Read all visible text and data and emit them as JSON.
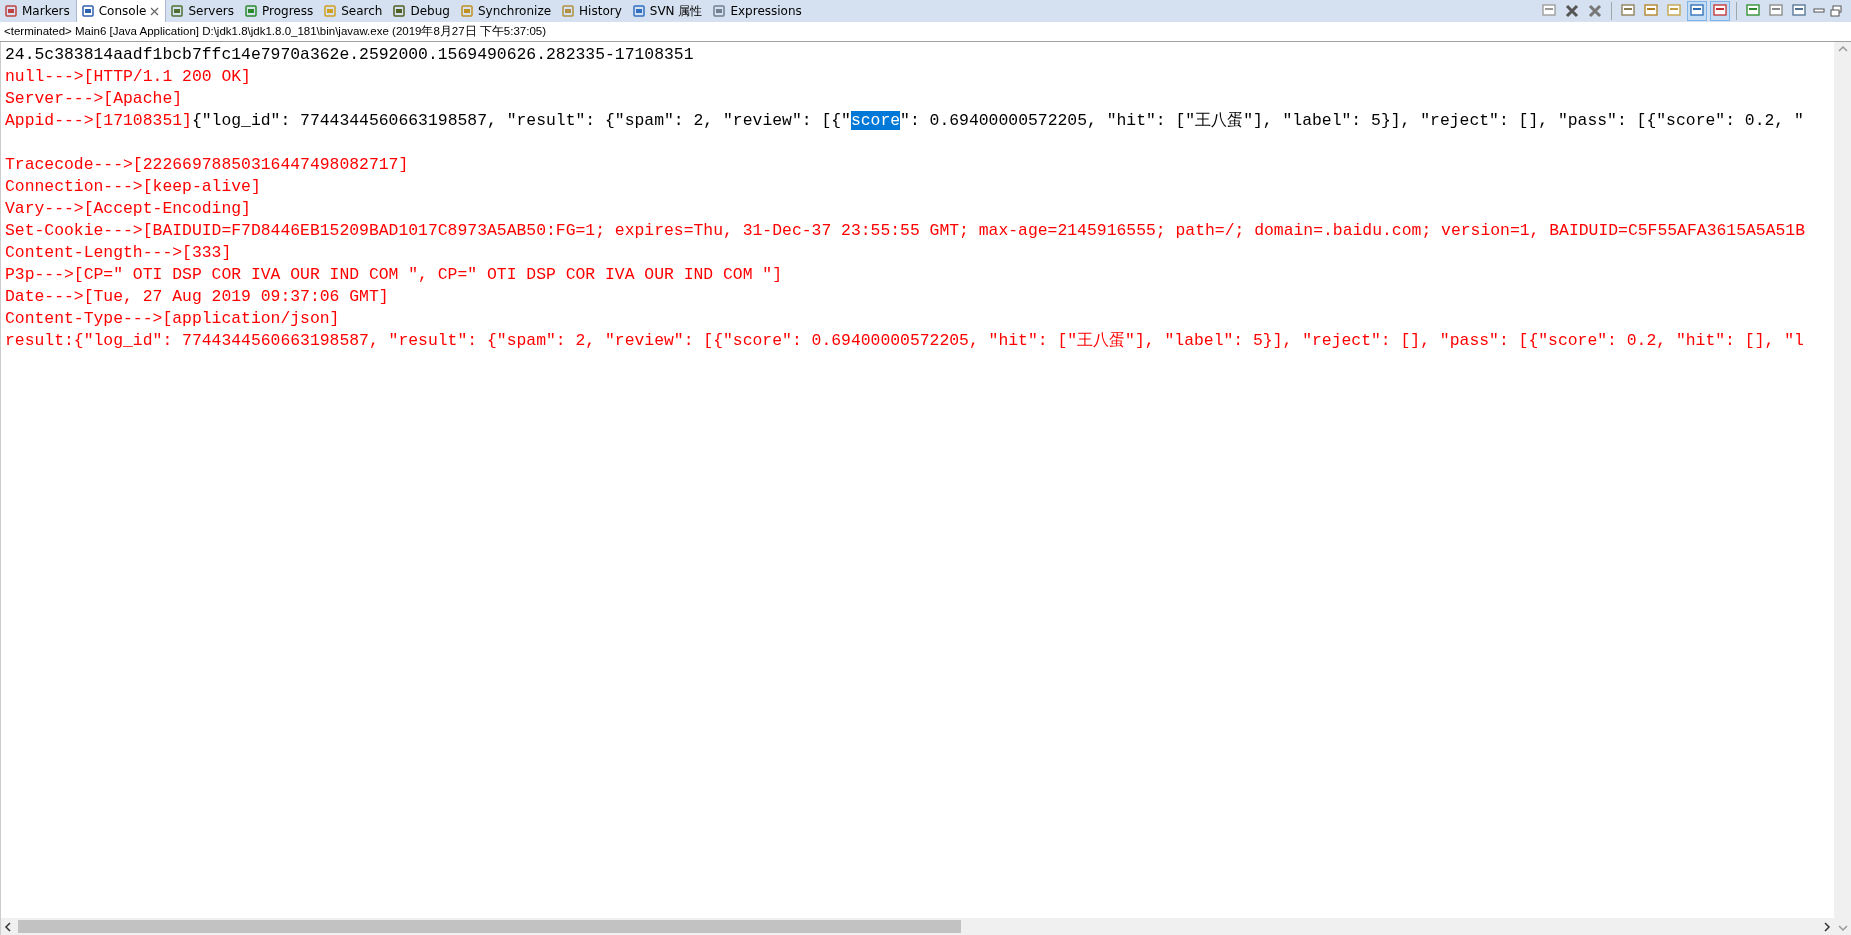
{
  "tabs": [
    {
      "label": "Markers",
      "selected": false
    },
    {
      "label": "Console",
      "selected": true
    },
    {
      "label": "Servers",
      "selected": false
    },
    {
      "label": "Progress",
      "selected": false
    },
    {
      "label": "Search",
      "selected": false
    },
    {
      "label": "Debug",
      "selected": false
    },
    {
      "label": "Synchronize",
      "selected": false
    },
    {
      "label": "History",
      "selected": false
    },
    {
      "label": "SVN 属性",
      "selected": false
    },
    {
      "label": "Expressions",
      "selected": false
    }
  ],
  "toolbar": [
    {
      "selected": false
    },
    {
      "selected": false
    },
    {
      "selected": false
    },
    {
      "selected": false
    },
    {
      "selected": false
    },
    {
      "selected": false
    },
    {
      "selected": true
    },
    {
      "selected": true
    },
    {
      "selected": false
    },
    {
      "selected": false
    },
    {
      "selected": false
    }
  ],
  "status": "<terminated> Main6 [Java Application] D:\\jdk1.8\\jdk1.8.0_181\\bin\\javaw.exe (2019年8月27日 下午5:37:05)",
  "lines": [
    {
      "kind": "text",
      "segments": [
        {
          "text": "24.5c383814aadf1bcb7ffc14e7970a362e.2592000.1569490626.282335-17108351",
          "color": "#000000",
          "selected": false
        }
      ]
    },
    {
      "kind": "text",
      "segments": [
        {
          "text": "null--->[HTTP/1.1 200 OK]",
          "color": "#ff0000",
          "selected": false
        }
      ]
    },
    {
      "kind": "text",
      "segments": [
        {
          "text": "Server--->[Apache]",
          "color": "#ff0000",
          "selected": false
        }
      ]
    },
    {
      "kind": "text",
      "segments": [
        {
          "text": "Appid--->[17108351]",
          "color": "#ff0000",
          "selected": false
        },
        {
          "text": "{\"log_id\": 7744344560663198587, \"result\": {\"spam\": 2, \"review\": [{\"",
          "color": "#000000",
          "selected": false
        },
        {
          "text": "score",
          "selected": true
        },
        {
          "text": "\": 0.69400000572205, \"hit\": [\"王八蛋\"], \"label\": 5}], \"reject\": [], \"pass\": [{\"score\": 0.2, \"",
          "color": "#000000",
          "selected": false
        }
      ]
    },
    {
      "kind": "blank"
    },
    {
      "kind": "text",
      "segments": [
        {
          "text": "Tracecode--->[22266978850316447498082717]",
          "color": "#ff0000",
          "selected": false
        }
      ]
    },
    {
      "kind": "text",
      "segments": [
        {
          "text": "Connection--->[keep-alive]",
          "color": "#ff0000",
          "selected": false
        }
      ]
    },
    {
      "kind": "text",
      "segments": [
        {
          "text": "Vary--->[Accept-Encoding]",
          "color": "#ff0000",
          "selected": false
        }
      ]
    },
    {
      "kind": "text",
      "segments": [
        {
          "text": "Set-Cookie--->[BAIDUID=F7D8446EB15209BAD1017C8973A5AB50:FG=1; expires=Thu, 31-Dec-37 23:55:55 GMT; max-age=2145916555; path=/; domain=.baidu.com; version=1, BAIDUID=C5F55AFA3615A5A51B",
          "color": "#ff0000",
          "selected": false
        }
      ]
    },
    {
      "kind": "text",
      "segments": [
        {
          "text": "Content-Length--->[333]",
          "color": "#ff0000",
          "selected": false
        }
      ]
    },
    {
      "kind": "text",
      "segments": [
        {
          "text": "P3p--->[CP=\" OTI DSP COR IVA OUR IND COM \", CP=\" OTI DSP COR IVA OUR IND COM \"]",
          "color": "#ff0000",
          "selected": false
        }
      ]
    },
    {
      "kind": "text",
      "segments": [
        {
          "text": "Date--->[Tue, 27 Aug 2019 09:37:06 GMT]",
          "color": "#ff0000",
          "selected": false
        }
      ]
    },
    {
      "kind": "text",
      "segments": [
        {
          "text": "Content-Type--->[application/json]",
          "color": "#ff0000",
          "selected": false
        }
      ]
    },
    {
      "kind": "text",
      "segments": [
        {
          "text": "result:{\"log_id\": 7744344560663198587, \"result\": {\"spam\": 2, \"review\": [{\"score\": 0.69400000572205, \"hit\": [\"王八蛋\"], \"label\": 5}], \"reject\": [], \"pass\": [{\"score\": 0.2, \"hit\": [], \"l",
          "color": "#ff0000",
          "selected": false
        }
      ]
    }
  ]
}
